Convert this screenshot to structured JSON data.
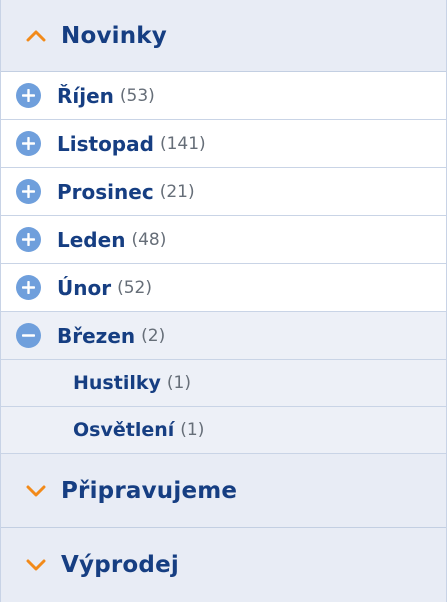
{
  "colors": {
    "accent_orange": "#f28a1a",
    "title_blue": "#163e82",
    "toggle_blue": "#6f9fdc",
    "count_gray": "#666e78"
  },
  "sections": {
    "novinky": {
      "title": "Novinky",
      "icon": "chevron-up-icon",
      "items": [
        {
          "label": "Říjen",
          "count": "(53)",
          "icon": "plus-circle-icon"
        },
        {
          "label": "Listopad",
          "count": "(141)",
          "icon": "plus-circle-icon"
        },
        {
          "label": "Prosinec",
          "count": "(21)",
          "icon": "plus-circle-icon"
        },
        {
          "label": "Leden",
          "count": "(48)",
          "icon": "plus-circle-icon"
        },
        {
          "label": "Únor",
          "count": "(52)",
          "icon": "plus-circle-icon"
        },
        {
          "label": "Březen",
          "count": "(2)",
          "icon": "minus-circle-icon",
          "children": [
            {
              "label": "Hustilky",
              "count": "(1)"
            },
            {
              "label": "Osvětlení",
              "count": "(1)"
            }
          ]
        }
      ]
    },
    "pripravujeme": {
      "title": "Připravujeme",
      "icon": "chevron-down-icon"
    },
    "vyprodej": {
      "title": "Výprodej",
      "icon": "chevron-down-icon"
    }
  }
}
